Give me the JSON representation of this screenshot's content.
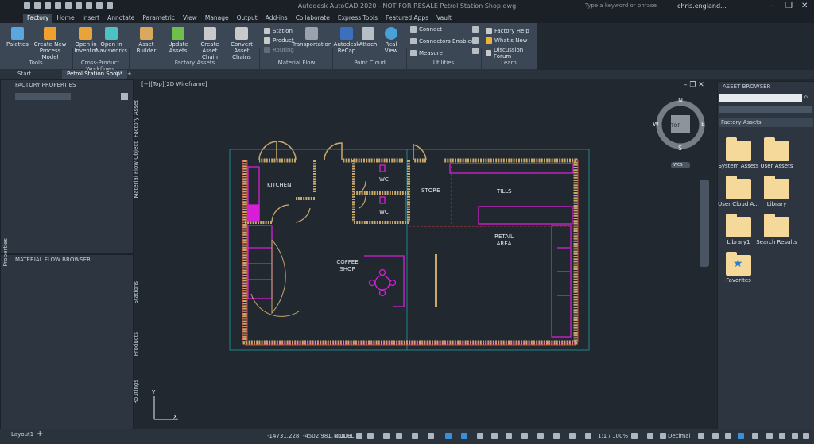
{
  "window": {
    "title": "Autodesk AutoCAD 2020 - NOT FOR RESALE   Petrol Station Shop.dwg",
    "search_placeholder": "Type a keyword or phrase",
    "user": "chris.england..."
  },
  "ribbon_tabs": [
    "Factory",
    "Home",
    "Insert",
    "Annotate",
    "Parametric",
    "View",
    "Manage",
    "Output",
    "Add-ins",
    "Collaborate",
    "Express Tools",
    "Featured Apps",
    "Vault"
  ],
  "ribbon": {
    "tools": {
      "palettes": "Palettes",
      "create_model": "Create New Process Model",
      "title": "Tools"
    },
    "cross_product": {
      "open_inventor": "Open in Inventor",
      "open_navisworks": "Open in Navisworks",
      "title": "Cross-Product Workflows"
    },
    "factory_assets": {
      "asset_builder": "Asset Builder",
      "update_assets": "Update Assets",
      "create_chain": "Create Asset Chain",
      "convert_chains": "Convert Asset Chains",
      "title": "Factory Assets"
    },
    "material_flow": {
      "station": "Station",
      "product": "Product",
      "routing": "Routing",
      "transportation": "Transportation",
      "title": "Material Flow"
    },
    "point_cloud": {
      "recap": "Autodesk ReCap",
      "attach": "Attach",
      "real_view": "Real View",
      "title": "Point Cloud"
    },
    "utilities": {
      "connect": "Connect",
      "connectors": "Connectors Enabled",
      "measure": "Measure",
      "title": "Utilities"
    },
    "learn": {
      "factory_help": "Factory Help",
      "whats_new": "What's New",
      "forum": "Discussion Forum",
      "title": "Learn"
    }
  },
  "file_tabs": {
    "start": "Start",
    "active": "Petrol Station Shop*"
  },
  "factory_properties": {
    "title": "FACTORY PROPERTIES",
    "side_tabs": [
      "Factory Asset",
      "Material Flow Object"
    ],
    "properties_tab": "Properties"
  },
  "material_flow_browser": {
    "title": "MATERIAL FLOW BROWSER",
    "side_tabs": [
      "Stations",
      "Products",
      "Routings"
    ]
  },
  "canvas": {
    "view_label": "[−][Top][2D Wireframe]",
    "rooms": [
      "KITCHEN",
      "WC",
      "WC",
      "STORE",
      "TILLS",
      "RETAIL AREA",
      "COFFEE SHOP"
    ],
    "viewcube": {
      "n": "N",
      "s": "S",
      "e": "E",
      "w": "W",
      "face": "TOP",
      "wcs": "WCS"
    },
    "ucs": {
      "x": "X",
      "y": "Y"
    }
  },
  "asset_browser": {
    "title": "ASSET BROWSER",
    "dropdown": "Factory Assets",
    "folders": [
      "System Assets",
      "User Assets",
      "User Cloud A...",
      "Library",
      "Library1",
      "Search Results",
      "Favorites"
    ]
  },
  "statusbar": {
    "layout_tab": "Layout1",
    "coords": "-14731.228, -4502.981, 0.000",
    "model": "MODEL",
    "scale": "1:1 / 100%",
    "units": "Decimal"
  },
  "colors": {
    "accent": "#3b4755",
    "wall": "#c8a86b",
    "magenta": "#d61fd6",
    "teal": "#1f9e9e",
    "red": "#d4433b"
  }
}
